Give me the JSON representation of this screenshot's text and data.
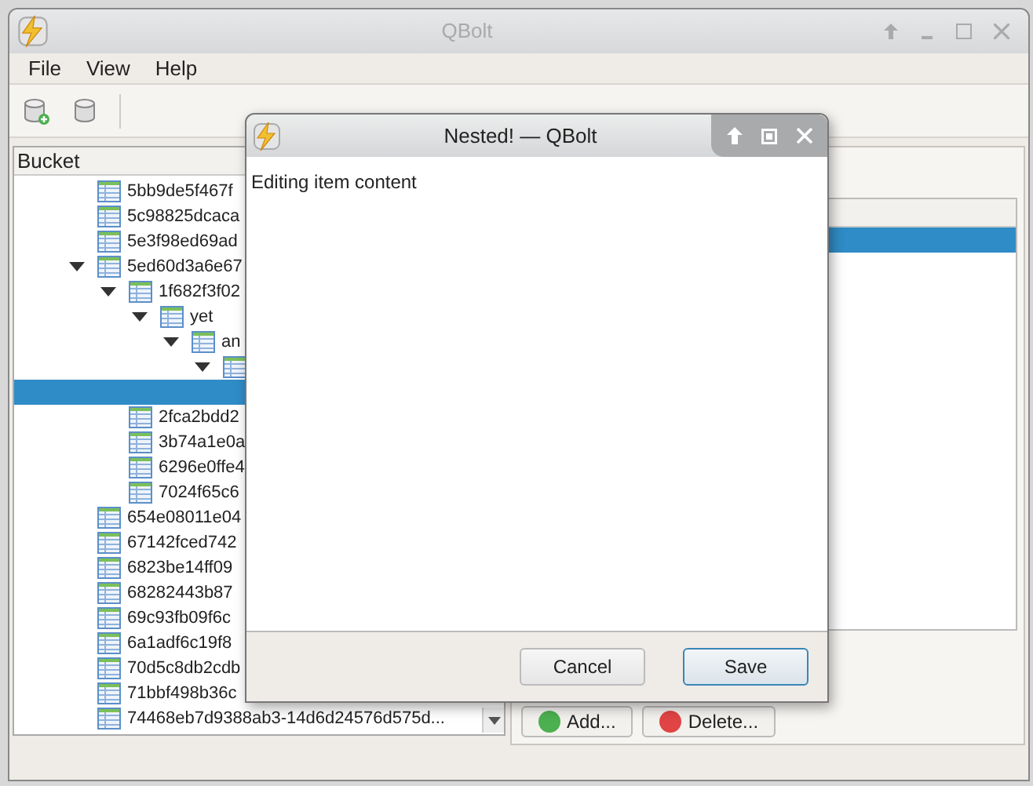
{
  "main_window": {
    "title": "QBolt",
    "menu": [
      {
        "label": "File"
      },
      {
        "label": "View"
      },
      {
        "label": "Help"
      }
    ],
    "tree": {
      "header": "Bucket",
      "items": [
        {
          "label": "5bb9de5f467f",
          "selected": false
        },
        {
          "label": "5c98825dcaca",
          "selected": false
        },
        {
          "label": "5e3f98ed69ad",
          "selected": false
        },
        {
          "label": "5ed60d3a6e67",
          "selected": false,
          "expanded": true,
          "children": [
            {
              "label": "1f682f3f02",
              "selected": false,
              "expanded": true,
              "children": [
                {
                  "label": "yet",
                  "selected": false,
                  "expanded": true,
                  "children": [
                    {
                      "label": "an",
                      "selected": false,
                      "expanded": true,
                      "children": [
                        {
                          "selected": false,
                          "expanded": true,
                          "children": [
                            {
                              "selected": true,
                              "icon": false
                            }
                          ]
                        }
                      ]
                    }
                  ]
                }
              ]
            },
            {
              "label": "2fca2bdd2",
              "selected": false
            },
            {
              "label": "3b74a1e0a",
              "selected": false
            },
            {
              "label": "6296e0ffe4",
              "selected": false
            },
            {
              "label": "7024f65c6",
              "selected": false
            }
          ]
        },
        {
          "label": "654e08011e04",
          "selected": false
        },
        {
          "label": "67142fced742",
          "selected": false
        },
        {
          "label": "6823be14ff09",
          "selected": false
        },
        {
          "label": "68282443b87",
          "selected": false
        },
        {
          "label": "69c93fb09f6c",
          "selected": false
        },
        {
          "label": "6a1adf6c19f8",
          "selected": false
        },
        {
          "label": "70d5c8db2cdb",
          "selected": false
        },
        {
          "label": "71bbf498b36c",
          "selected": false
        },
        {
          "label": "74468eb7d9388ab3-14d6d24576d575d...",
          "selected": false
        }
      ]
    },
    "list": {
      "rows": [
        {
          "selected": true
        }
      ]
    },
    "buttons": [
      {
        "label": "Add...",
        "kind": "add"
      },
      {
        "label": "Delete...",
        "kind": "delete"
      }
    ]
  },
  "dialog": {
    "title": "Nested! — QBolt",
    "label": "Editing item content",
    "buttons": [
      {
        "label": "Cancel",
        "default": false
      },
      {
        "label": "Save",
        "default": true
      }
    ]
  }
}
